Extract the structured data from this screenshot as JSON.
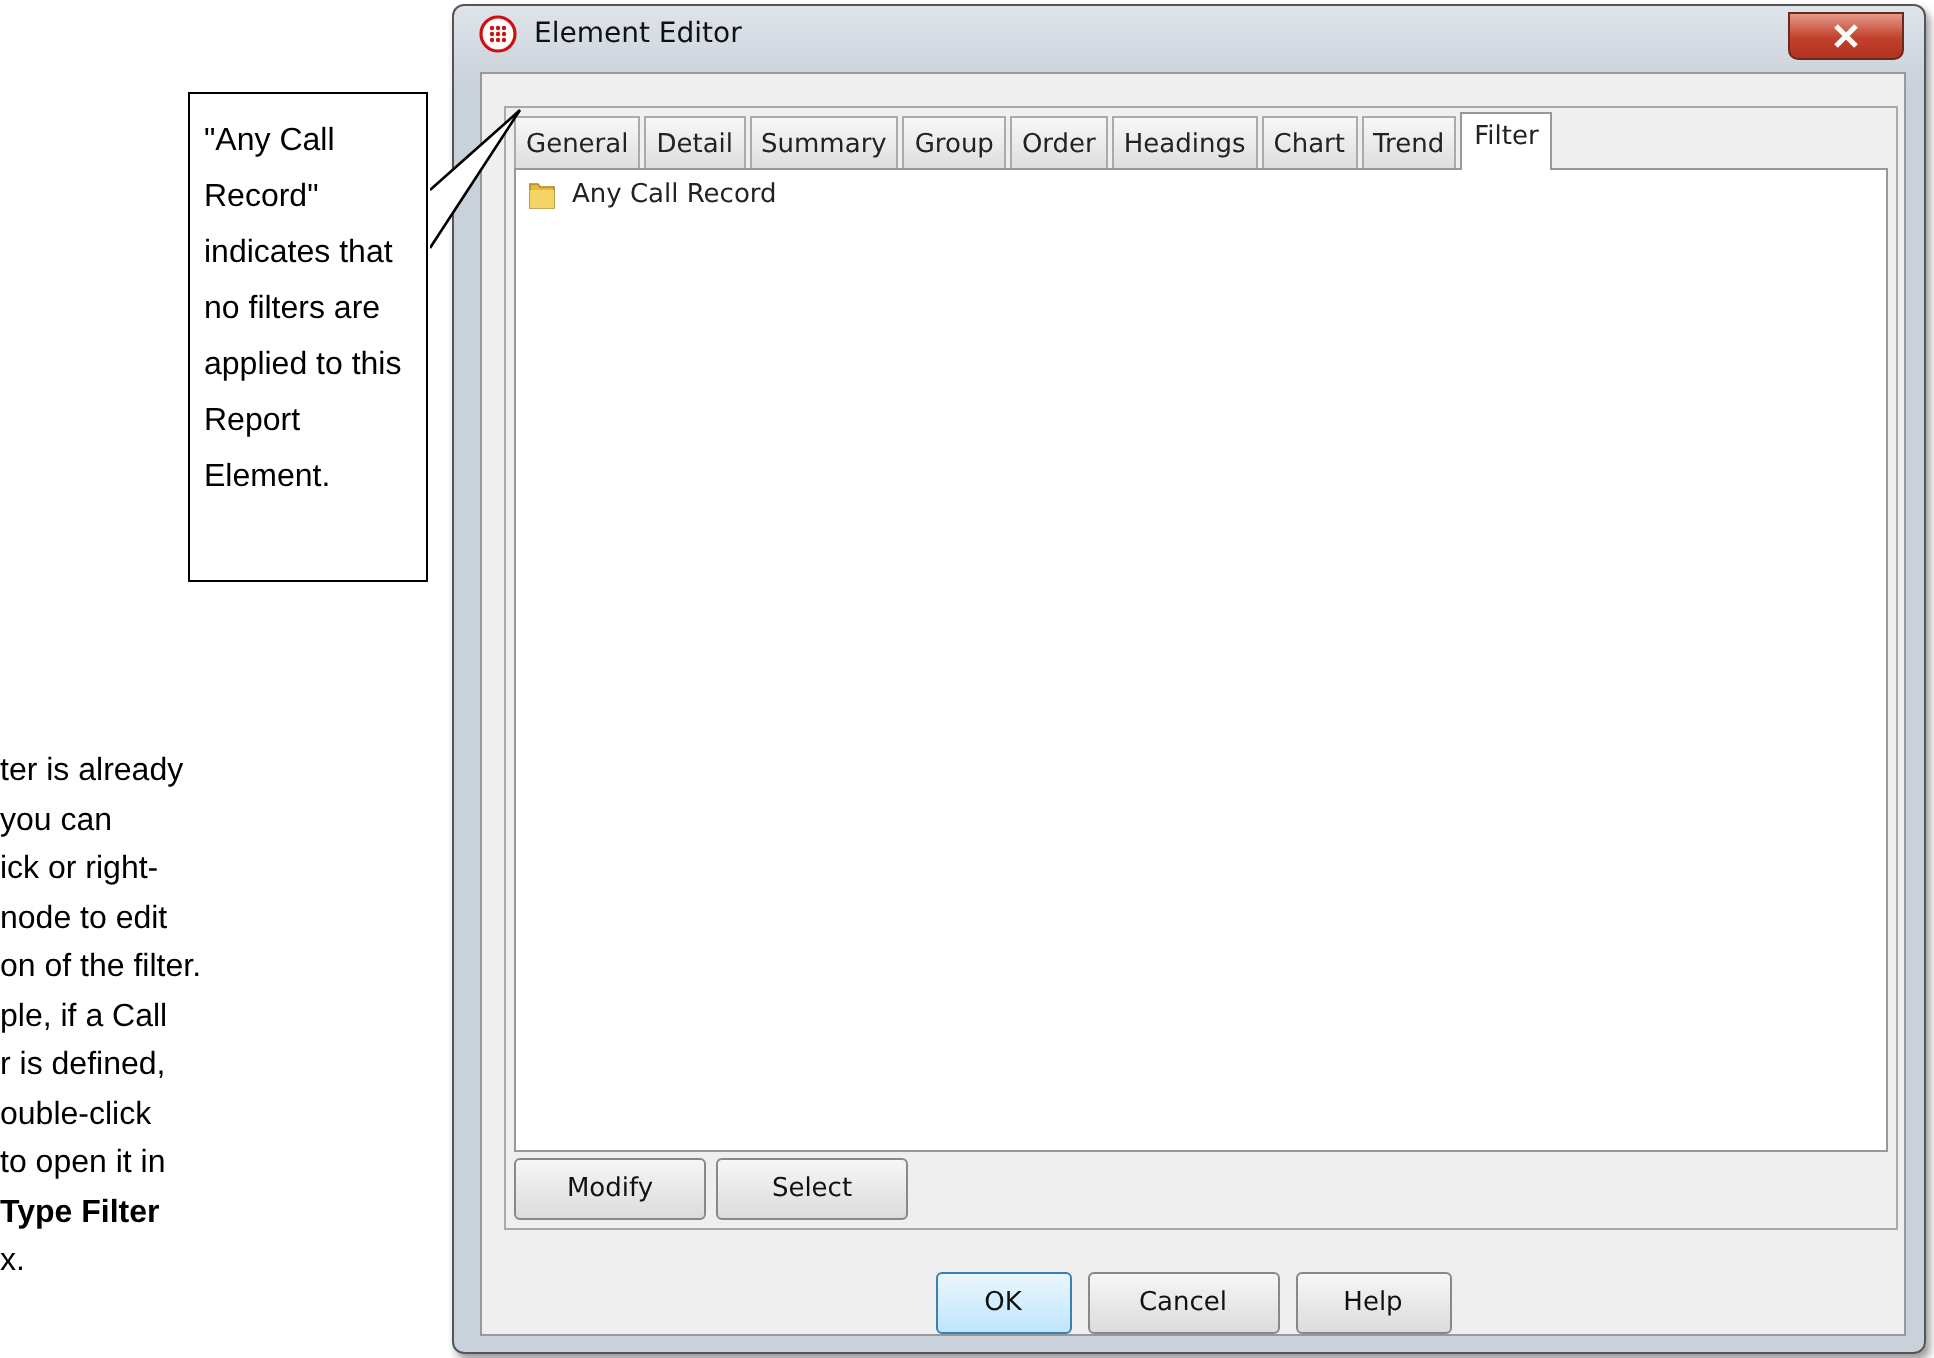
{
  "window": {
    "title": "Element Editor"
  },
  "tabs": [
    {
      "label": "General",
      "selected": false
    },
    {
      "label": "Detail",
      "selected": false
    },
    {
      "label": "Summary",
      "selected": false
    },
    {
      "label": "Group",
      "selected": false
    },
    {
      "label": "Order",
      "selected": false
    },
    {
      "label": "Headings",
      "selected": false
    },
    {
      "label": "Chart",
      "selected": false
    },
    {
      "label": "Trend",
      "selected": false
    },
    {
      "label": "Filter",
      "selected": true
    }
  ],
  "tree": {
    "items": [
      {
        "label": "Any Call Record"
      }
    ]
  },
  "panel_buttons": [
    {
      "label": "Modify"
    },
    {
      "label": "Select"
    }
  ],
  "buttons": [
    {
      "label": "OK",
      "default": true
    },
    {
      "label": "Cancel",
      "default": false
    },
    {
      "label": "Help",
      "default": false
    }
  ],
  "callout": {
    "text": "\"Any Call Record\" indicates that no filters are applied to this Report Element."
  },
  "body_text": {
    "lines": [
      "ter is already",
      "you can",
      "ick or right-",
      "node to edit",
      "on of the filter.",
      "ple, if a Call",
      "r is defined,",
      "ouble-click",
      "to open it in",
      "**Type Filter**",
      "x."
    ]
  }
}
